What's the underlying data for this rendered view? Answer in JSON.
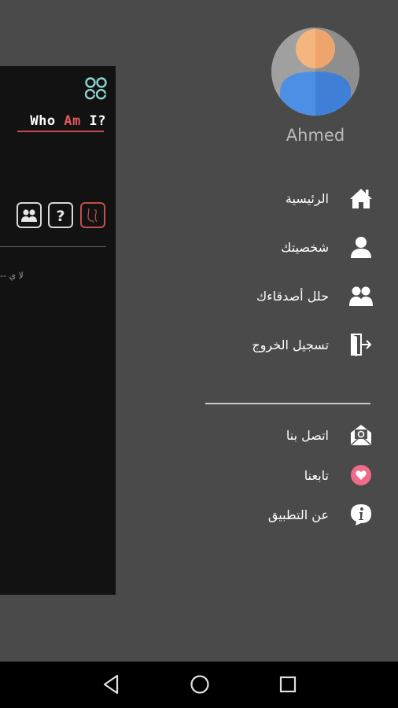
{
  "main_card": {
    "title_part1": "Who ",
    "title_part2": "Am",
    "title_part3": " I?",
    "snippet": "-- لا ي",
    "buttons": [
      {
        "icon": "friends-icon"
      },
      {
        "icon": "question-icon"
      },
      {
        "icon": "sketch-icon"
      }
    ]
  },
  "drawer": {
    "user_name": "Ahmed",
    "menu_primary": [
      {
        "label": "الرئيسية",
        "icon": "home-icon"
      },
      {
        "label": "شخصيتك",
        "icon": "person-icon"
      },
      {
        "label": "حلل أصدقاءك",
        "icon": "group-icon"
      },
      {
        "label": "تسجيل الخروج",
        "icon": "logout-icon"
      }
    ],
    "menu_secondary": [
      {
        "label": "اتصل بنا",
        "icon": "mail-icon"
      },
      {
        "label": "تابعنا",
        "icon": "heart-icon"
      },
      {
        "label": "عن التطبيق",
        "icon": "info-icon"
      }
    ]
  },
  "colors": {
    "background": "#4a4a4a",
    "card": "#121212",
    "accent_red": "#e0595f",
    "logo_teal": "#8fd3d0",
    "heart_pink": "#f06a8a"
  },
  "navbar": {
    "buttons": [
      "back-icon",
      "home-circle-icon",
      "recents-icon"
    ]
  }
}
